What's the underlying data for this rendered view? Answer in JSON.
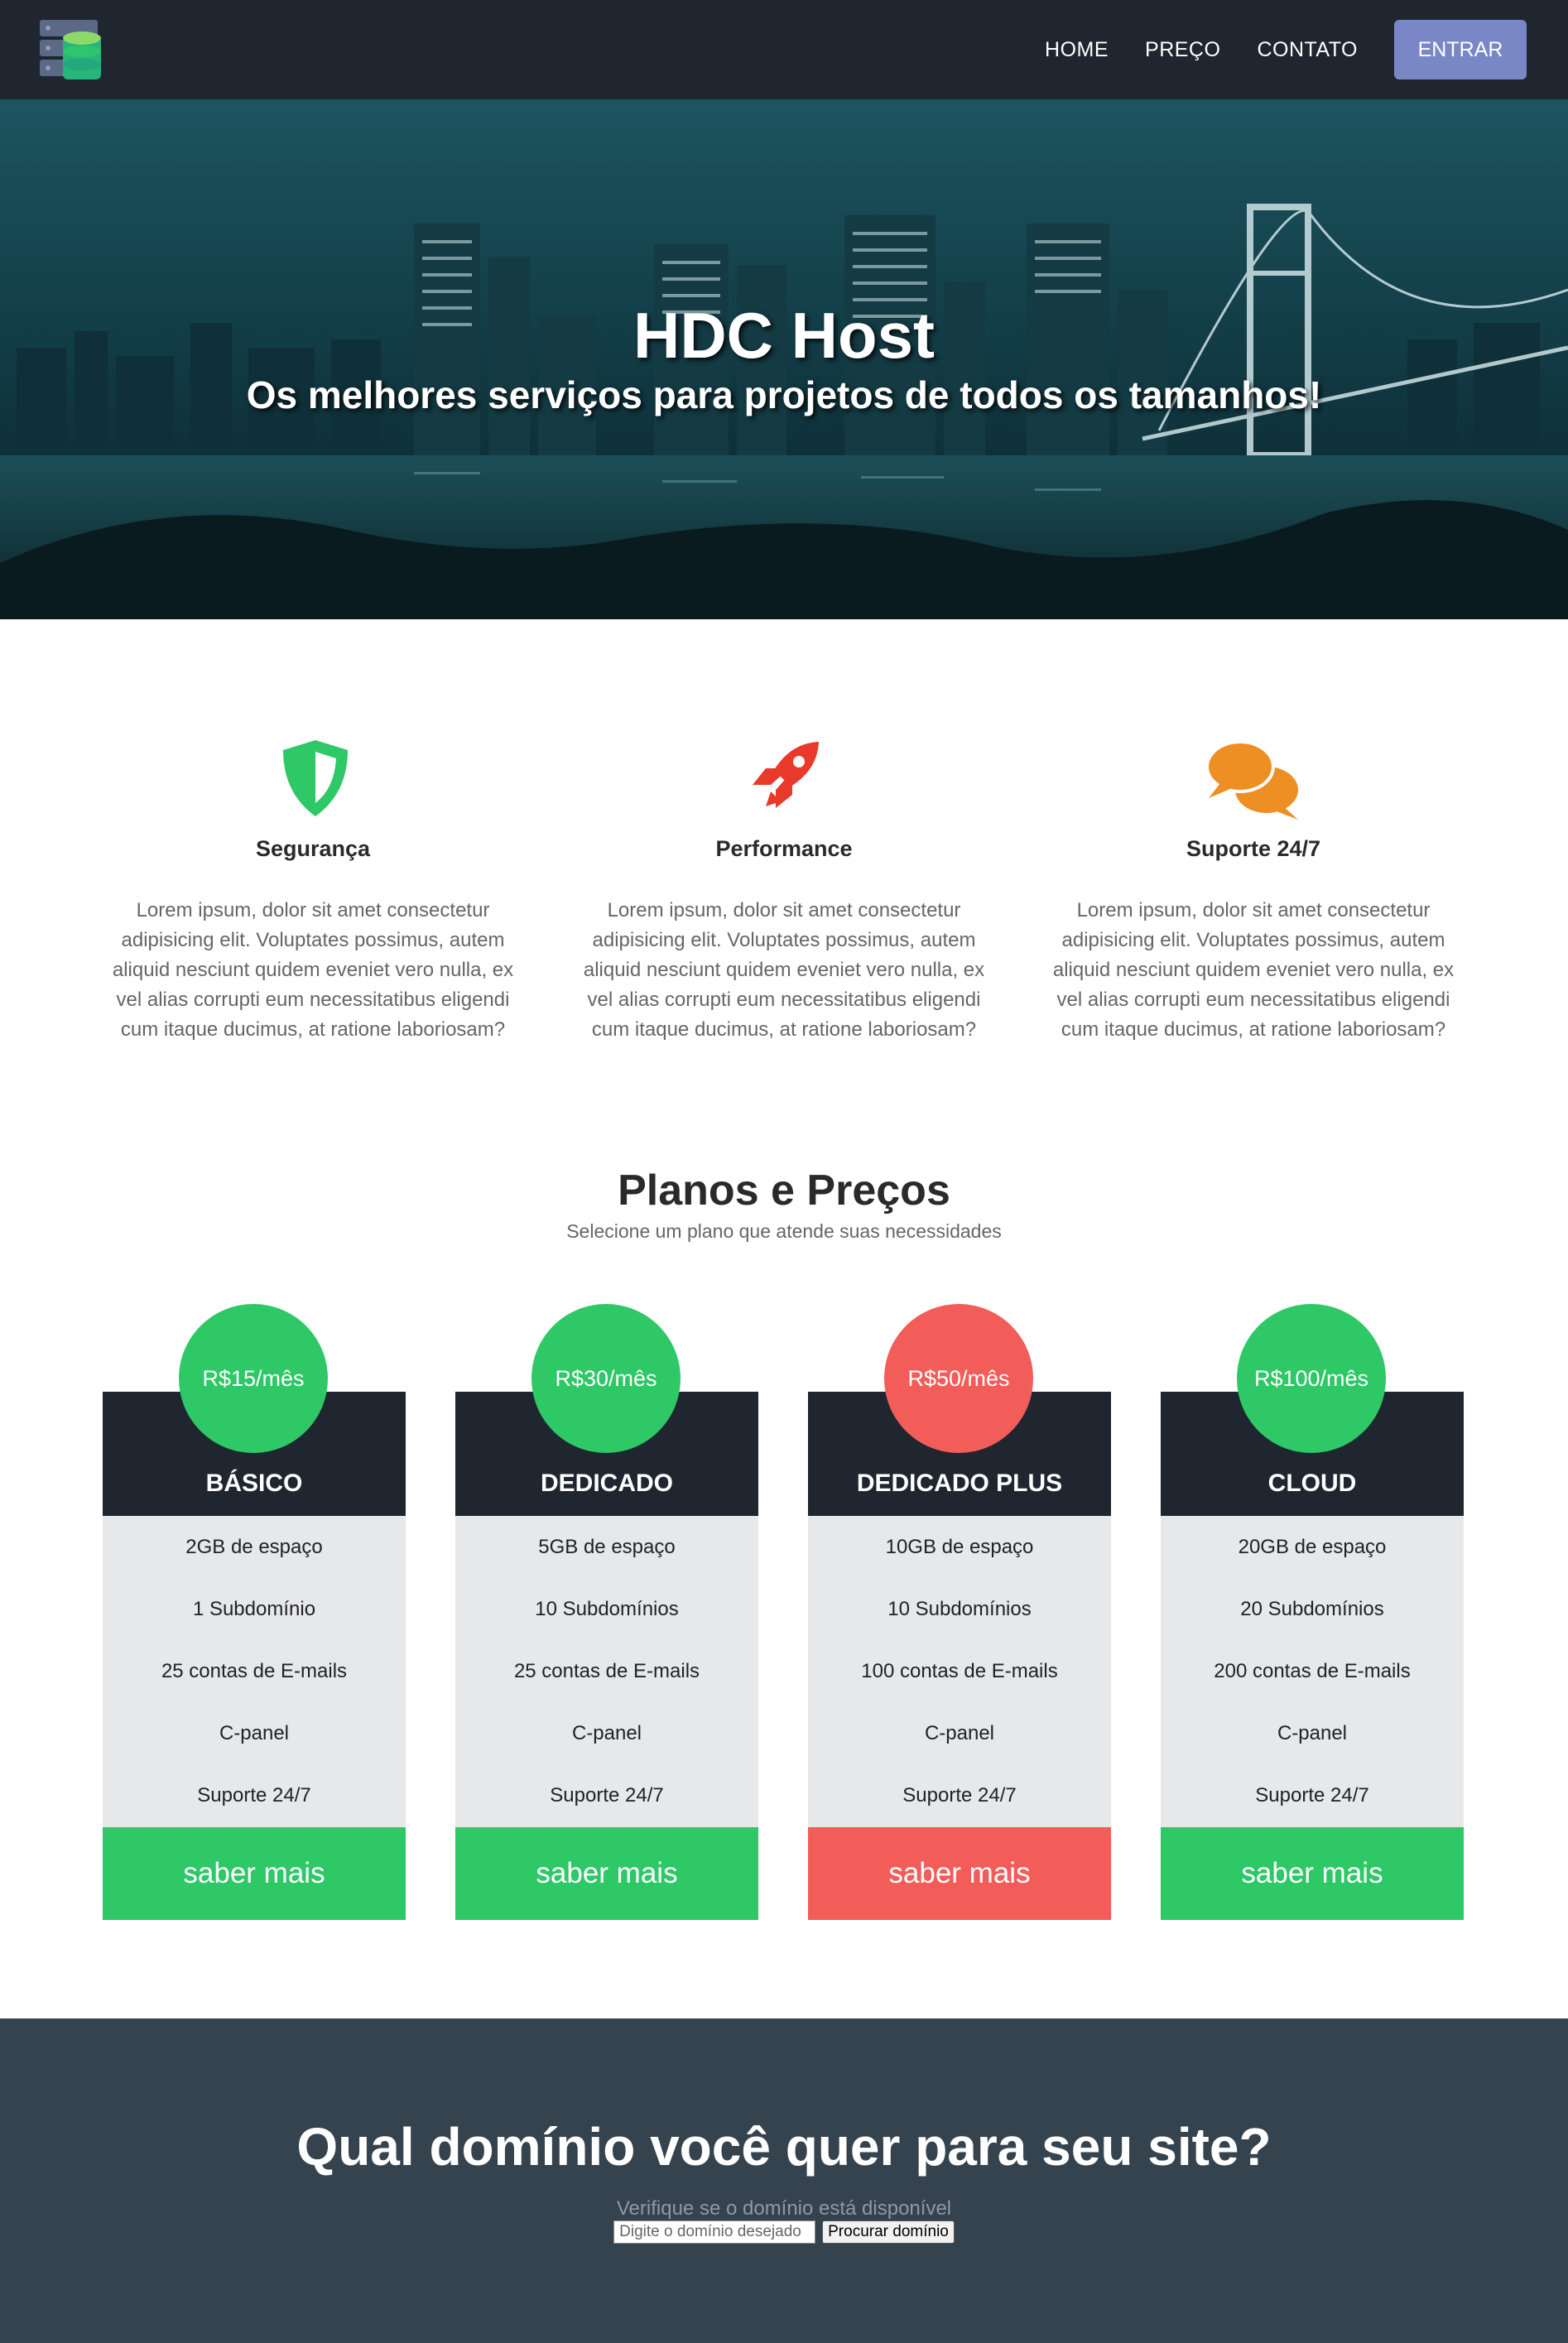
{
  "nav": {
    "links": [
      "HOME",
      "PREÇO",
      "CONTATO"
    ],
    "login_label": "ENTRAR"
  },
  "hero": {
    "title": "HDC Host",
    "subtitle": "Os melhores serviços para projetos de todos os tamanhos!"
  },
  "features": [
    {
      "icon": "shield-icon",
      "title": "Segurança",
      "text": "Lorem ipsum, dolor sit amet consectetur adipisicing elit. Voluptates possimus, autem aliquid nesciunt quidem eveniet vero nulla, ex vel alias corrupti eum necessitatibus eligendi cum itaque ducimus, at ratione laboriosam?",
      "color": "#2ec866"
    },
    {
      "icon": "rocket-icon",
      "title": "Performance",
      "text": "Lorem ipsum, dolor sit amet consectetur adipisicing elit. Voluptates possimus, autem aliquid nesciunt quidem eveniet vero nulla, ex vel alias corrupti eum necessitatibus eligendi cum itaque ducimus, at ratione laboriosam?",
      "color": "#e8392b"
    },
    {
      "icon": "chat-bubbles-icon",
      "title": "Suporte 24/7",
      "text": "Lorem ipsum, dolor sit amet consectetur adipisicing elit. Voluptates possimus, autem aliquid nesciunt quidem eveniet vero nulla, ex vel alias corrupti eum necessitatibus eligendi cum itaque ducimus, at ratione laboriosam?",
      "color": "#ee8f24"
    }
  ],
  "pricing": {
    "title": "Planos e Preços",
    "subtitle": "Selecione um plano que atende suas necessidades",
    "plans": [
      {
        "price": "R$15/mês",
        "name": "BÁSICO",
        "features": [
          "2GB de espaço",
          "1 Subdomínio",
          "25 contas de E-mails",
          "C-panel",
          "Suporte 24/7"
        ],
        "button": "saber mais",
        "accent": "#2ec866"
      },
      {
        "price": "R$30/mês",
        "name": "DEDICADO",
        "features": [
          "5GB de espaço",
          "10 Subdomínios",
          "25 contas de E-mails",
          "C-panel",
          "Suporte 24/7"
        ],
        "button": "saber mais",
        "accent": "#2ec866"
      },
      {
        "price": "R$50/mês",
        "name": "DEDICADO PLUS",
        "features": [
          "10GB de espaço",
          "10 Subdomínios",
          "100 contas de E-mails",
          "C-panel",
          "Suporte 24/7"
        ],
        "button": "saber mais",
        "accent": "#f25c59"
      },
      {
        "price": "R$100/mês",
        "name": "CLOUD",
        "features": [
          "20GB de espaço",
          "20 Subdomínios",
          "200 contas de E-mails",
          "C-panel",
          "Suporte 24/7"
        ],
        "button": "saber mais",
        "accent": "#2ec866"
      }
    ]
  },
  "domain": {
    "title": "Qual domínio você quer para seu site?",
    "subtitle": "Verifique se o domínio está disponível",
    "input_placeholder": "Digite o domínio desejado",
    "button_label": "Procurar domínio"
  }
}
